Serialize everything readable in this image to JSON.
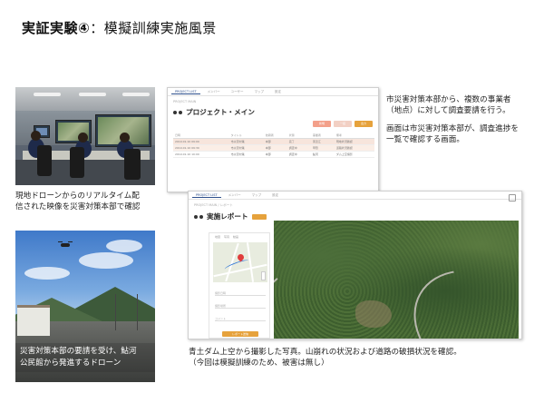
{
  "title": {
    "strong": "実証実験④",
    "rest": "：模擬訓練実施風景"
  },
  "photo_room": {
    "caption_line1": "現地ドローンからのリアルタイム配",
    "caption_line2": "信された映像を災害対策本部で確認"
  },
  "photo_drone": {
    "caption_line1": "災害対策本部の要請を受け、鮎河",
    "caption_line2": "公民館から発進するドローン"
  },
  "screen_main": {
    "nav_tabs": [
      "PROJECT LIST",
      "メンバー",
      "ユーザー",
      "マップ",
      "設定"
    ],
    "breadcrumb": "PROJECT MAIN",
    "heading": "プロジェクト・メイン",
    "buttons": [
      "新規",
      "一括",
      "出力"
    ],
    "columns": [
      "日時",
      "タイトル",
      "依頼者",
      "状態",
      "事業者",
      "備考"
    ],
    "rows": [
      [
        "2019.01.10 09:00",
        "市災害対策",
        "本部",
        "完了",
        "東近江",
        "現地状況確認"
      ],
      [
        "2019.01.10 09:30",
        "市災害対策",
        "本部",
        "調査中",
        "甲賀",
        "道路状況確認"
      ],
      [
        "2019.01.10 10:00",
        "市災害対策",
        "本部",
        "調査中",
        "鮎河",
        "ダム上空撮影"
      ]
    ]
  },
  "note_main": {
    "p1_line1": "市災害対策本部から、複数の事業者",
    "p1_line2": "（地点）に対して調査要請を行う。",
    "p2_line1": "画面は市災害対策本部が、調査進捗を",
    "p2_line2": "一覧で確認する画面。"
  },
  "screen_report": {
    "nav_tabs": [
      "PROJECT LIST",
      "メンバー",
      "マップ",
      "設定"
    ],
    "breadcrumb": "PROJECT MAIN / レポート",
    "heading": "実施レポート",
    "panel_tabs": [
      "地図",
      "写真",
      "動画"
    ],
    "fields": [
      "撮影日時",
      "撮影場所",
      "コメント"
    ],
    "submit": "レポート送信"
  },
  "caption_aerial": {
    "line1": "青土ダム上空から撮影した写真。山崩れの状況および道路の破損状況を確認。",
    "line2": "（今回は模擬訓練のため、被害は無し）"
  },
  "colors": {
    "accent_orange": "#e6a23c",
    "brand_blue": "#2d4f8c",
    "highlight_row": "#f7e5dc"
  }
}
